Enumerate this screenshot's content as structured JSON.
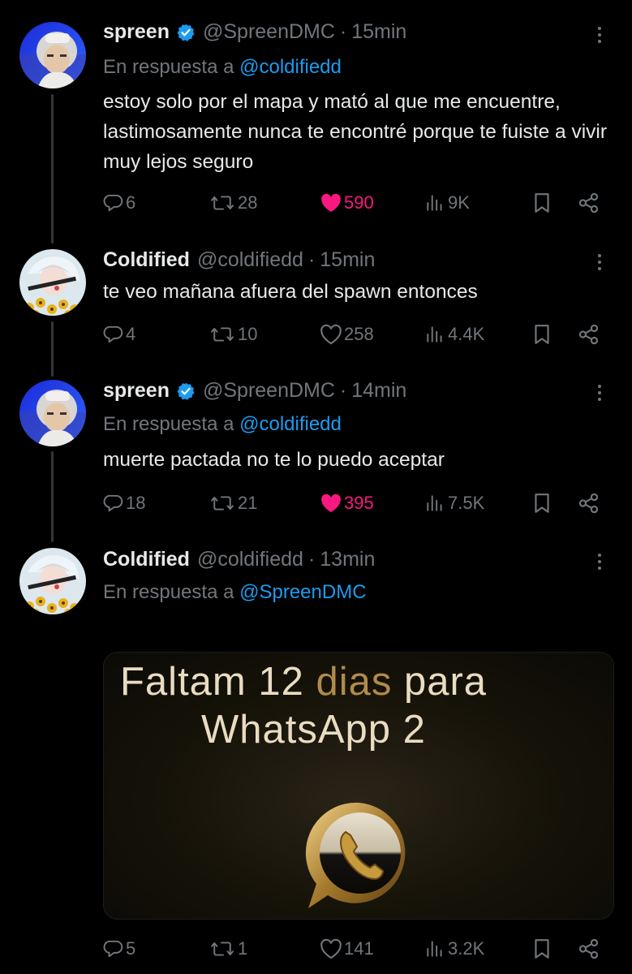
{
  "tweets": [
    {
      "name": "spreen",
      "verified": true,
      "handle": "@SpreenDMC",
      "separator": "·",
      "time": "15min",
      "reply_prefix": "En respuesta a",
      "reply_to": "@coldifiedd",
      "text": "estoy solo por el mapa y mató al que me encuentre, lastimosamente nunca te encontré porque te fuiste a vivir muy lejos seguro",
      "replies": "6",
      "reposts": "28",
      "likes": "590",
      "liked": true,
      "views": "9K"
    },
    {
      "name": "Coldified",
      "verified": false,
      "handle": "@coldifiedd",
      "separator": "·",
      "time": "15min",
      "text": "te veo mañana afuera del spawn entonces",
      "replies": "4",
      "reposts": "10",
      "likes": "258",
      "liked": false,
      "views": "4.4K"
    },
    {
      "name": "spreen",
      "verified": true,
      "handle": "@SpreenDMC",
      "separator": "·",
      "time": "14min",
      "reply_prefix": "En respuesta a",
      "reply_to": "@coldifiedd",
      "text": "muerte pactada no te lo puedo aceptar",
      "replies": "18",
      "reposts": "21",
      "likes": "395",
      "liked": true,
      "views": "7.5K"
    },
    {
      "name": "Coldified",
      "verified": false,
      "handle": "@coldifiedd",
      "separator": "·",
      "time": "13min",
      "reply_prefix": "En respuesta a",
      "reply_to": "@SpreenDMC",
      "media": {
        "line1_a": "Faltam 12 ",
        "line1_b": "dias",
        "line1_c": " para",
        "line2": "WhatsApp 2"
      },
      "replies": "5",
      "reposts": "1",
      "likes": "141",
      "liked": false,
      "views": "3.2K"
    }
  ],
  "colors": {
    "background": "#000000",
    "text": "#e7e9ea",
    "muted": "#71767b",
    "link": "#1d9bf0",
    "like": "#f91880",
    "verified": "#1d9bf0"
  },
  "icons": {
    "reply": "reply-icon",
    "repost": "repost-icon",
    "like": "heart-icon",
    "views": "views-icon",
    "bookmark": "bookmark-icon",
    "share": "share-icon",
    "more": "more-icon",
    "verified": "verified-badge-icon"
  }
}
